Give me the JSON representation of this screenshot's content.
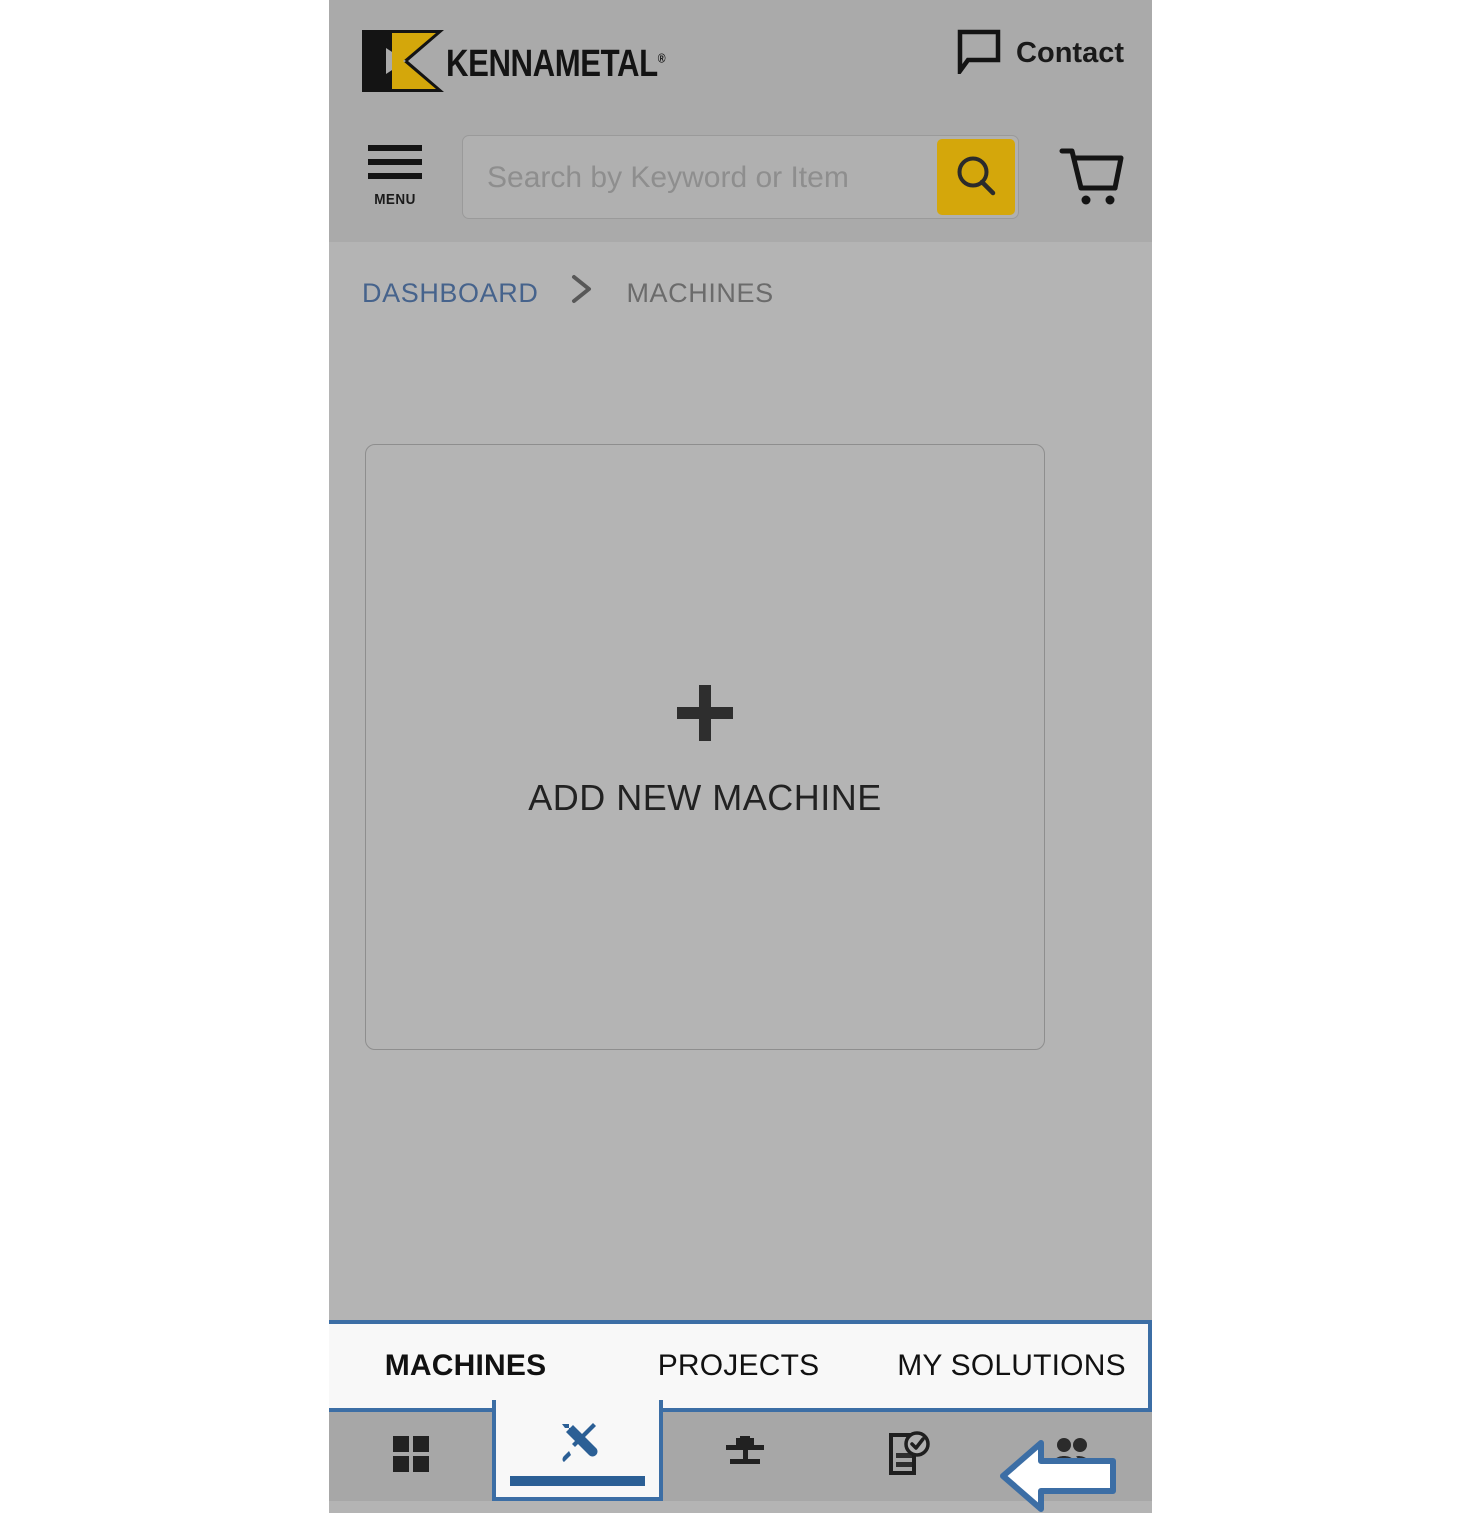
{
  "brand": {
    "logo_text": "KENNAMETAL",
    "logo_trademark": "®",
    "logo_icon": "kennametal-k-logo",
    "colors": {
      "gold": "#d4a70b",
      "logo_black": "#141414",
      "accent_blue": "#3c6ea5",
      "link_blue": "#46638c",
      "header_gray": "#aaaaaa",
      "body_gray": "#b4b4b4",
      "nav_gray": "#a7a7a7"
    }
  },
  "header": {
    "contact_label": "Contact",
    "contact_icon": "speech-bubble-icon",
    "menu_label": "MENU",
    "menu_icon": "hamburger-menu-icon",
    "cart_icon": "shopping-cart-icon"
  },
  "search": {
    "placeholder": "Search by Keyword or Item",
    "value": "",
    "submit_icon": "magnifier-icon"
  },
  "breadcrumb": {
    "items": [
      {
        "label": "DASHBOARD",
        "current": false
      },
      {
        "label": "MACHINES",
        "current": true
      }
    ],
    "separator": "›",
    "separator_icon": "chevron-right-icon"
  },
  "main": {
    "add_card": {
      "plus": "+",
      "plus_icon": "plus-icon",
      "label": "ADD NEW MACHINE"
    }
  },
  "tabbar": {
    "tabs": [
      {
        "label": "MACHINES",
        "active": true
      },
      {
        "label": "PROJECTS",
        "active": false
      },
      {
        "label": "MY SOLUTIONS",
        "active": false
      }
    ]
  },
  "iconnav": {
    "items": [
      {
        "icon": "grid-dashboard-icon",
        "selected": false
      },
      {
        "icon": "tools-wrench-screwdriver-icon",
        "selected": true
      },
      {
        "icon": "machine-lathe-icon",
        "selected": false
      },
      {
        "icon": "clipboard-check-icon",
        "selected": false
      },
      {
        "icon": "people-group-icon",
        "selected": false
      }
    ]
  },
  "annotation": {
    "arrow_icon": "left-pointing-arrow-annotation",
    "direction": "left",
    "fill": "#ffffff",
    "stroke": "#3c6ea5"
  }
}
